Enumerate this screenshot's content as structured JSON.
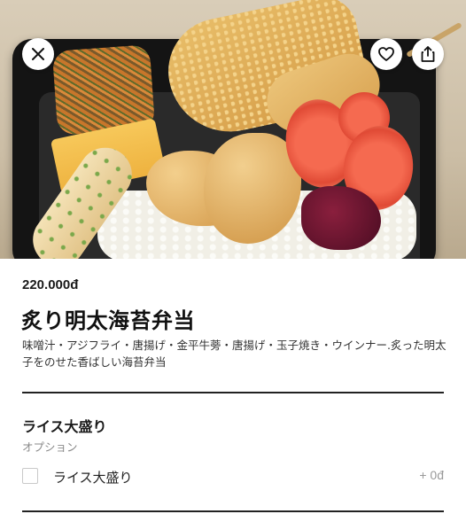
{
  "header": {
    "close_icon": "close-icon",
    "favorite_icon": "heart-icon",
    "share_icon": "share-icon"
  },
  "item": {
    "price": "220.000đ",
    "title": "炙り明太海苔弁当",
    "description": "味噌汁・アジフライ・唐揚げ・金平牛蒡・唐揚げ・玉子焼き・ウインナー.炙った明太子をのせた香ばしい海苔弁当"
  },
  "options": {
    "group_title": "ライス大盛り",
    "group_subtitle": "オプション",
    "choices": [
      {
        "label": "ライス大盛り",
        "price": "+ 0đ",
        "checked": false
      }
    ]
  },
  "colors": {
    "text": "#1a1a1a",
    "muted": "#888888",
    "divider": "#222222"
  }
}
